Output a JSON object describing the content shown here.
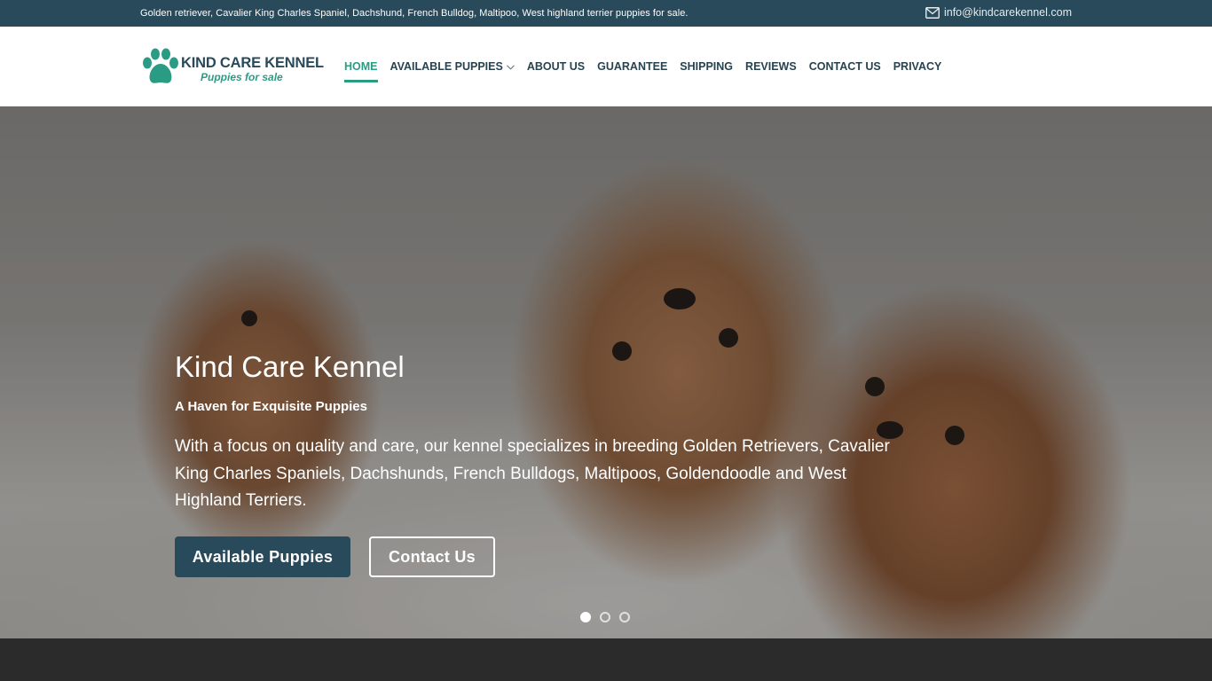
{
  "topbar": {
    "text": "Golden retriever, Cavalier King Charles Spaniel, Dachshund, French Bulldog, Maltipoo, West highland terrier puppies for sale.",
    "email": "info@kindcarekennel.com",
    "email_icon": "envelope-icon"
  },
  "logo": {
    "title": "KIND CARE KENNEL",
    "subtitle": "Puppies for sale",
    "icon": "paw-icon"
  },
  "nav": {
    "items": [
      {
        "label": "HOME",
        "active": true
      },
      {
        "label": "AVAILABLE PUPPIES",
        "has_dropdown": true
      },
      {
        "label": "ABOUT US"
      },
      {
        "label": "GUARANTEE"
      },
      {
        "label": "SHIPPING"
      },
      {
        "label": "REVIEWS"
      },
      {
        "label": "CONTACT US"
      },
      {
        "label": "PRIVACY"
      }
    ]
  },
  "hero": {
    "title": "Kind Care Kennel",
    "subtitle": "A Haven for Exquisite Puppies",
    "text": "With a focus on quality and care, our kennel specializes in breeding Golden Retrievers, Cavalier King Charles Spaniels, Dachshunds, French Bulldogs, Maltipoos, Goldendoodle and West Highland Terriers.",
    "primary_button": "Available Puppies",
    "secondary_button": "Contact Us",
    "slides": 3,
    "active_slide": 1
  },
  "colors": {
    "brand_dark": "#284a5a",
    "brand_accent": "#2a9c84",
    "footer": "#2b2b2b"
  }
}
